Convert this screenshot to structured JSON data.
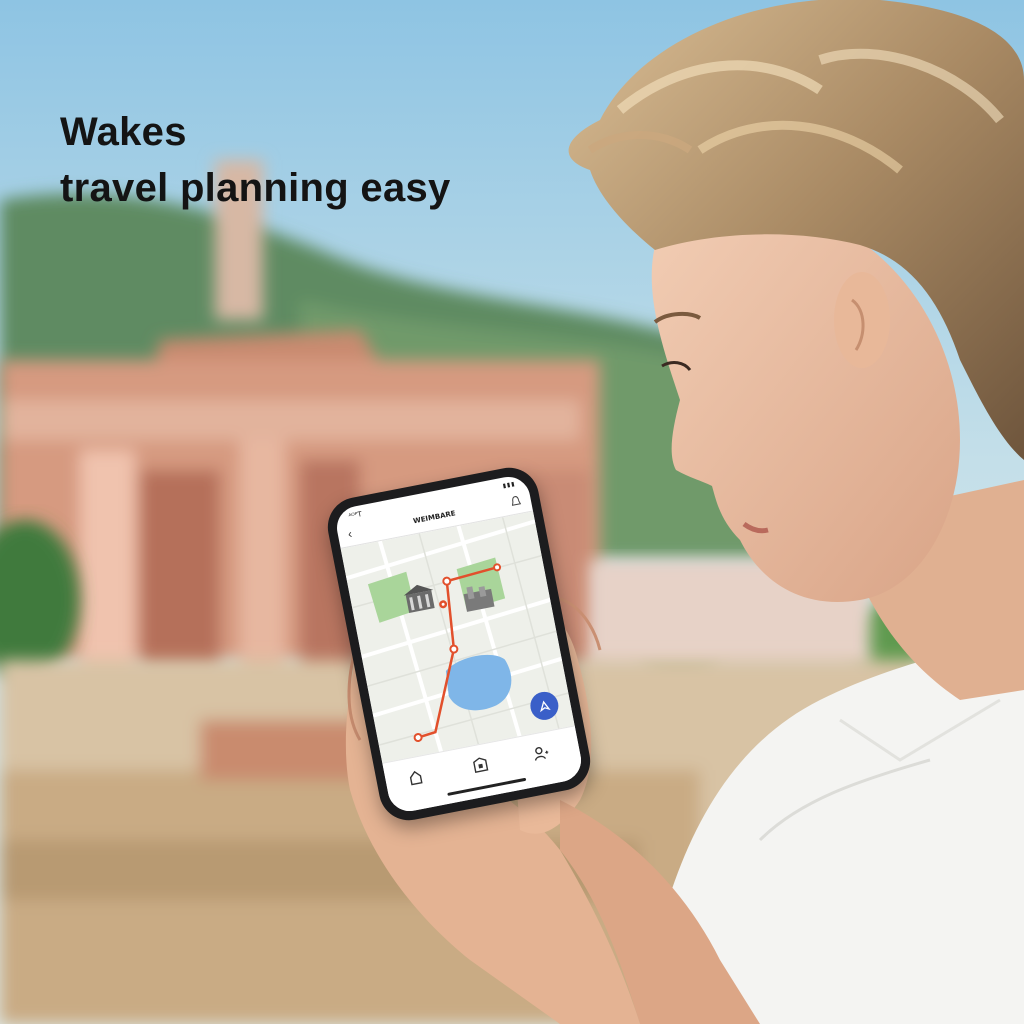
{
  "headline": {
    "line1": "Wakes",
    "line2": "travel planning easy"
  },
  "phone": {
    "status_time": "ᴬᴼᴾT",
    "status_signal": "▮▮▮",
    "app_title": "WEIMBARE",
    "icons": [
      "back-chevron-icon",
      "bell-icon",
      "navigate-icon",
      "home-icon",
      "map-icon",
      "profile-icon"
    ]
  },
  "colors": {
    "route": "#e2502c",
    "fab": "#3a5fc8",
    "water": "#7fb6e8",
    "park": "#a9d59a"
  }
}
